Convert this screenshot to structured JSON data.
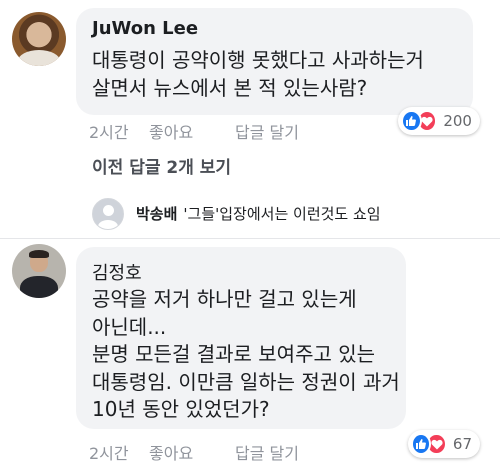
{
  "comments": [
    {
      "author": "JuWon Lee",
      "lines": [
        "대통령이 공약이행 못했다고 사과하는거",
        "살면서 뉴스에서 본 적 있는사람?"
      ],
      "time": "2시간",
      "like_label": "좋아요",
      "reply_label": "답글 달기",
      "reaction_count": "200",
      "reactions": [
        "like-icon",
        "love-icon"
      ]
    },
    {
      "author": "김정호",
      "lines": [
        "공약을 저거 하나만 걸고 있는게",
        "아닌데...",
        "분명 모든걸 결과로 보여주고 있는",
        "대통령임. 이만큼 일하는 정권이 과거",
        "10년 동안 있었던가?"
      ],
      "time": "2시간",
      "like_label": "좋아요",
      "reply_label": "답글 달기",
      "reaction_count": "67",
      "reactions": [
        "like-icon",
        "love-icon"
      ]
    }
  ],
  "replies_link": "이전 답글 2개 보기",
  "reply_preview": {
    "author": "박송배",
    "text": "'그들'입장에서는 이런것도 쇼임"
  },
  "colors": {
    "bubble": "#f2f3f5",
    "like_blue": "#1877f2",
    "love_red": "#f33e58",
    "meta_gray": "#90949c"
  }
}
